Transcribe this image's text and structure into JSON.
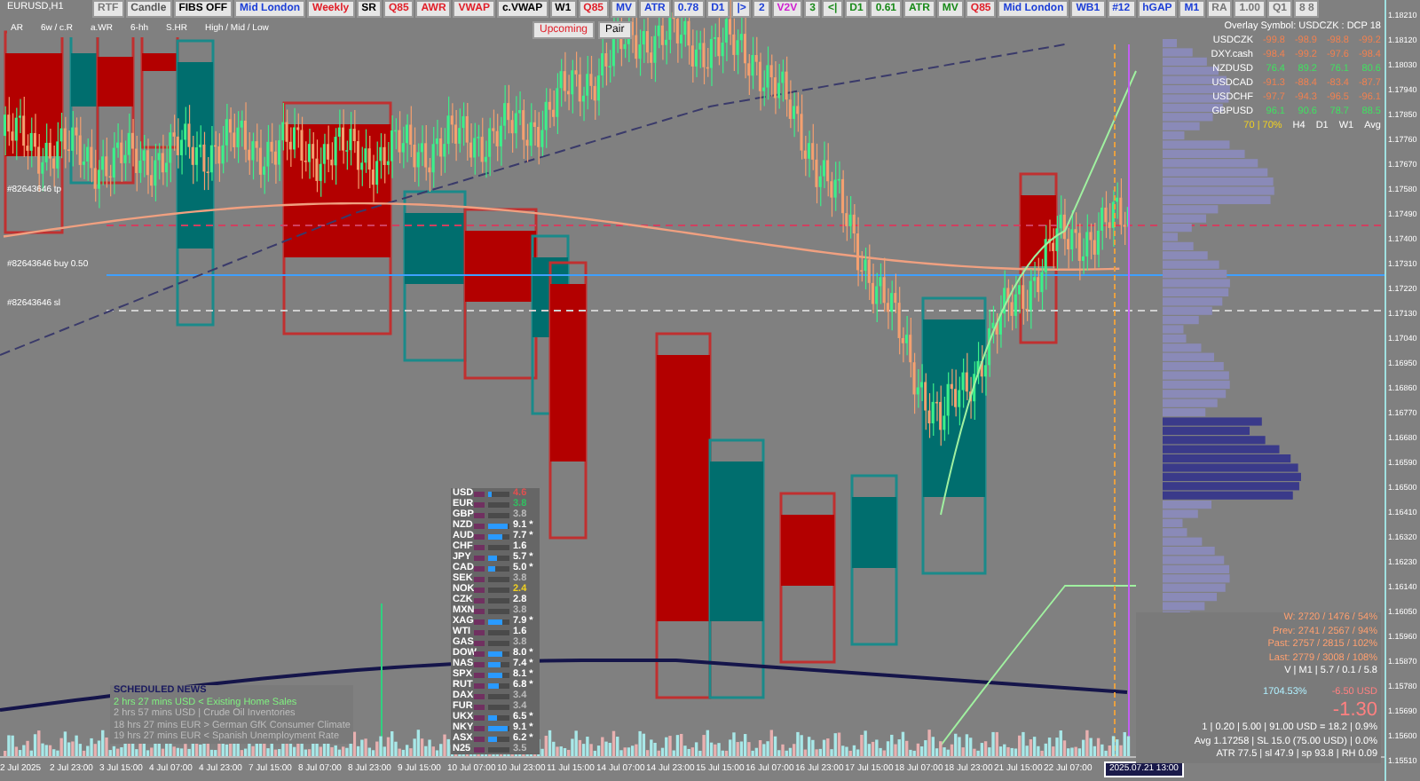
{
  "symbol": "EURUSD,H1",
  "toolbar": [
    {
      "label": "RTF",
      "color": "#777777"
    },
    {
      "label": "Candle",
      "color": "#555555"
    },
    {
      "label": "FIBS OFF",
      "color": "#000000"
    },
    {
      "label": "Mid London",
      "color": "#1d3fd6"
    },
    {
      "label": "Weekly",
      "color": "#e0202a"
    },
    {
      "label": "SR",
      "color": "#000000"
    },
    {
      "label": "Q85",
      "color": "#e0202a"
    },
    {
      "label": "AWR",
      "color": "#e0202a"
    },
    {
      "label": "VWAP",
      "color": "#e0202a"
    },
    {
      "label": "c.VWAP",
      "color": "#000000"
    },
    {
      "label": "W1",
      "color": "#000000"
    },
    {
      "label": "Q85",
      "color": "#e0202a"
    },
    {
      "label": "MV",
      "color": "#1d3fd6"
    },
    {
      "label": "ATR",
      "color": "#1d3fd6"
    },
    {
      "label": "0.78",
      "color": "#1d3fd6"
    },
    {
      "label": "D1",
      "color": "#1d3fd6"
    },
    {
      "label": "|>",
      "color": "#1d3fd6"
    },
    {
      "label": "2",
      "color": "#1d3fd6"
    },
    {
      "label": "V2V",
      "color": "#d01fd0"
    },
    {
      "label": "3",
      "color": "#1a8a1a"
    },
    {
      "label": "<|",
      "color": "#1a8a1a"
    },
    {
      "label": "D1",
      "color": "#1a8a1a"
    },
    {
      "label": "0.61",
      "color": "#1a8a1a"
    },
    {
      "label": "ATR",
      "color": "#1a8a1a"
    },
    {
      "label": "MV",
      "color": "#1a8a1a"
    },
    {
      "label": "Q85",
      "color": "#e0202a"
    },
    {
      "label": "Mid London",
      "color": "#1d3fd6"
    },
    {
      "label": "WB1",
      "color": "#1d3fd6"
    },
    {
      "label": "#12",
      "color": "#1d3fd6"
    },
    {
      "label": "hGAP",
      "color": "#1d3fd6"
    },
    {
      "label": "M1",
      "color": "#1d3fd6"
    },
    {
      "label": "RA",
      "color": "#777777"
    },
    {
      "label": "1.00",
      "color": "#777777"
    },
    {
      "label": "Q1",
      "color": "#777777"
    },
    {
      "label": "8 8",
      "color": "#777777"
    }
  ],
  "toolbar_row2": [
    {
      "label": "Upcoming",
      "color": "#e0202a"
    },
    {
      "label": "Pair",
      "color": "#000000"
    }
  ],
  "range_header": [
    "AR",
    "6w / c.R",
    "a.WR",
    "6-hh",
    "S.HR",
    "High / Mid / Low"
  ],
  "order_labels": [
    "#82643646 tp",
    "#82643646 buy 0.50",
    "#82643646 sl"
  ],
  "overlay": {
    "title": "Overlay Symbol: USDCZK : DCP 18",
    "rows": [
      {
        "symbol": "USDCZK",
        "values": [
          "-99.8",
          "-98.9",
          "-98.8",
          "-99.2"
        ],
        "color": "#f08050"
      },
      {
        "symbol": "DXY.cash",
        "values": [
          "-98.4",
          "-99.2",
          "-97.6",
          "-98.4"
        ],
        "color": "#f08050"
      },
      {
        "symbol": "NZDUSD",
        "values": [
          "76.4",
          "89.2",
          "76.1",
          "80.6"
        ],
        "color": "#40e060"
      },
      {
        "symbol": "USDCAD",
        "values": [
          "-91.3",
          "-88.4",
          "-83.4",
          "-87.7"
        ],
        "color": "#f08050"
      },
      {
        "symbol": "USDCHF",
        "values": [
          "-97.7",
          "-94.3",
          "-96.5",
          "-96.1"
        ],
        "color": "#f08050"
      },
      {
        "symbol": "GBPUSD",
        "values": [
          "96.1",
          "90.6",
          "78.7",
          "88.5"
        ],
        "color": "#40e060"
      }
    ],
    "footer": [
      "70 | 70%",
      "H4",
      "D1",
      "W1",
      "Avg"
    ]
  },
  "stats": {
    "ranges": [
      "W: 2720 / 1476 / 54%",
      "Prev: 2741 / 2567 / 94%",
      "Past: 2757 / 2815 / 102%",
      "Last: 2779 / 3008 / 108%"
    ],
    "volume": "V | M1 | 5.7 / 0.1 / 5.8",
    "percent": "1704.53%",
    "pnl": "-6.50 USD",
    "big": "-1.30",
    "lines": [
      "1 | 0.20 | 5.00 | 91.00 USD = 18.2 | 0.9%",
      "Avg 1.17258 | SL 15.0 (75.00 USD) | 0.0%",
      "ATR 77.5 | sl 47.9 | sp 93.8 | RH 0.09"
    ]
  },
  "strength": [
    {
      "name": "USD",
      "value": "4.6",
      "level": 0.15,
      "color": "#e05050"
    },
    {
      "name": "EUR",
      "value": "3.8",
      "level": 0,
      "color": "#30c060"
    },
    {
      "name": "GBP",
      "value": "3.8",
      "level": 0,
      "color": "#bbbbbb"
    },
    {
      "name": "NZD",
      "value": "9.1 *",
      "level": 0.9,
      "color": "#ffffff"
    },
    {
      "name": "AUD",
      "value": "7.7 *",
      "level": 0.65,
      "color": "#ffffff"
    },
    {
      "name": "CHF",
      "value": "1.6",
      "level": 0,
      "color": "#ffffff"
    },
    {
      "name": "JPY",
      "value": "5.7 *",
      "level": 0.4,
      "color": "#ffffff"
    },
    {
      "name": "CAD",
      "value": "5.0 *",
      "level": 0.35,
      "color": "#ffffff"
    },
    {
      "name": "SEK",
      "value": "3.8",
      "level": 0,
      "color": "#bbbbbb"
    },
    {
      "name": "NOK",
      "value": "2.4",
      "level": 0,
      "color": "#f0d020"
    },
    {
      "name": "CZK",
      "value": "2.8",
      "level": 0,
      "color": "#ffffff"
    },
    {
      "name": "MXN",
      "value": "3.8",
      "level": 0,
      "color": "#bbbbbb"
    },
    {
      "name": "XAG",
      "value": "7.9 *",
      "level": 0.65,
      "color": "#ffffff"
    },
    {
      "name": "WTI",
      "value": "1.6",
      "level": 0,
      "color": "#ffffff"
    },
    {
      "name": "GAS",
      "value": "3.8",
      "level": 0,
      "color": "#bbbbbb"
    },
    {
      "name": "DOW",
      "value": "8.0 *",
      "level": 0.7,
      "color": "#ffffff"
    },
    {
      "name": "NAS",
      "value": "7.4 *",
      "level": 0.6,
      "color": "#ffffff"
    },
    {
      "name": "SPX",
      "value": "8.1 *",
      "level": 0.7,
      "color": "#ffffff"
    },
    {
      "name": "RUT",
      "value": "6.8 *",
      "level": 0.5,
      "color": "#ffffff"
    },
    {
      "name": "DAX",
      "value": "3.4",
      "level": 0,
      "color": "#bbbbbb"
    },
    {
      "name": "FUR",
      "value": "3.4",
      "level": 0,
      "color": "#bbbbbb"
    },
    {
      "name": "UKX",
      "value": "6.5 *",
      "level": 0.45,
      "color": "#ffffff"
    },
    {
      "name": "NKY",
      "value": "9.1 *",
      "level": 0.9,
      "color": "#ffffff"
    },
    {
      "name": "ASX",
      "value": "6.2 *",
      "level": 0.45,
      "color": "#ffffff"
    },
    {
      "name": "N25",
      "value": "3.5",
      "level": 0,
      "color": "#bbbbbb"
    }
  ],
  "news": {
    "title": "SCHEDULED NEWS",
    "items": [
      {
        "text": "2 hrs 27 mins  USD  <  Existing Home Sales",
        "color": "#80f080"
      },
      {
        "text": "2 hrs 57 mins  USD  |  Crude Oil Inventories",
        "color": "#bdbdbd"
      },
      {
        "text": "18 hrs 27 mins  EUR  >  German GfK Consumer Climate",
        "color": "#bdbdbd"
      },
      {
        "text": "19 hrs 27 mins  EUR  <  Spanish Unemployment Rate",
        "color": "#bdbdbd"
      }
    ]
  },
  "price_axis": [
    "1.18210",
    "1.18120",
    "1.18030",
    "1.17940",
    "1.17850",
    "1.17760",
    "1.17670",
    "1.17580",
    "1.17490",
    "1.17400",
    "1.17310",
    "1.17220",
    "1.17130",
    "1.17040",
    "1.16950",
    "1.16860",
    "1.16770",
    "1.16680",
    "1.16590",
    "1.16500",
    "1.16410",
    "1.16320",
    "1.16230",
    "1.16140",
    "1.16050",
    "1.15960",
    "1.15870",
    "1.15780",
    "1.15690",
    "1.15600",
    "1.15510"
  ],
  "time_axis": [
    "2 Jul 2025",
    "2 Jul 23:00",
    "3 Jul 15:00",
    "4 Jul 07:00",
    "4 Jul 23:00",
    "7 Jul 15:00",
    "8 Jul 07:00",
    "8 Jul 23:00",
    "9 Jul 15:00",
    "10 Jul 07:00",
    "10 Jul 23:00",
    "11 Jul 15:00",
    "14 Jul 07:00",
    "14 Jul 23:00",
    "15 Jul 15:00",
    "16 Jul 07:00",
    "16 Jul 23:00",
    "17 Jul 15:00",
    "18 Jul 07:00",
    "18 Jul 23:00",
    "21 Jul 15:00",
    "22 Jul 07:00"
  ],
  "cursor_time": "2025.07.21 13:00"
}
